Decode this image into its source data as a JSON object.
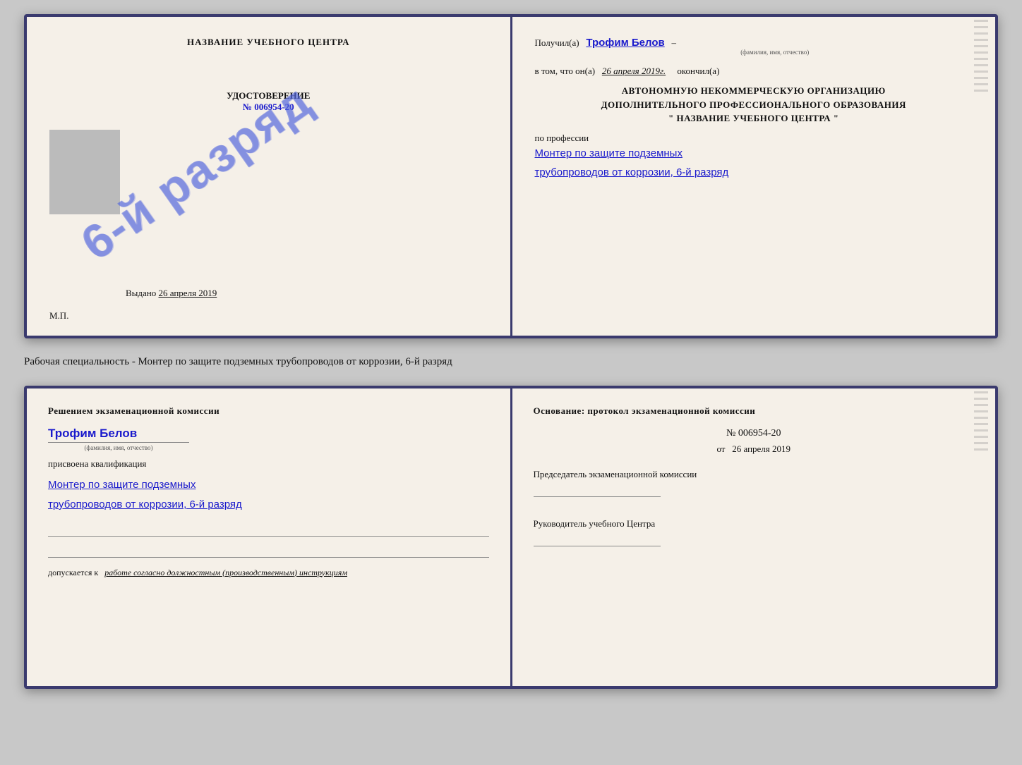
{
  "cert": {
    "left": {
      "title": "НАЗВАНИЕ УЧЕБНОГО ЦЕНТРА",
      "udostoverenie_label": "УДОСТОВЕРЕНИЕ",
      "number": "№ 006954-20",
      "stamp_text": "6-й разряд",
      "vydano_label": "Выдано",
      "vydano_date": "26 апреля 2019",
      "mp_label": "М.П."
    },
    "right": {
      "poluchil_label": "Получил(а)",
      "name": "Трофим Белов",
      "fio_label": "(фамилия, имя, отчество)",
      "vtom_label": "в том, что он(а)",
      "date": "26 апреля 2019г.",
      "okkonchil_label": "окончил(а)",
      "org_line1": "АВТОНОМНУЮ НЕКОММЕРЧЕСКУЮ ОРГАНИЗАЦИЮ",
      "org_line2": "ДОПОЛНИТЕЛЬНОГО ПРОФЕССИОНАЛЬНОГО ОБРАЗОВАНИЯ",
      "org_line3": "\"   НАЗВАНИЕ УЧЕБНОГО ЦЕНТРА   \"",
      "professii_label": "по профессии",
      "professii_line1": "Монтер по защите подземных",
      "professii_line2": "трубопроводов от коррозии, 6-й разряд"
    }
  },
  "middle": {
    "text": "Рабочая специальность - Монтер по защите подземных трубопроводов от коррозии, 6-й разряд"
  },
  "back": {
    "left": {
      "title": "Решением экзаменационной комиссии",
      "name": "Трофим Белов",
      "fio_label": "(фамилия, имя, отчество)",
      "prisvoena_label": "присвоена квалификация",
      "qual_line1": "Монтер по защите подземных",
      "qual_line2": "трубопроводов от коррозии, 6-й разряд",
      "dopuskaetsya_label": "допускается к",
      "dopusk_val": "работе согласно должностным (производственным) инструкциям"
    },
    "right": {
      "title": "Основание: протокол экзаменационной комиссии",
      "number": "№  006954-20",
      "ot_label": "от",
      "ot_date": "26 апреля 2019",
      "predsedatel_label": "Председатель экзаменационной комиссии",
      "rukovoditel_label": "Руководитель учебного Центра"
    }
  }
}
